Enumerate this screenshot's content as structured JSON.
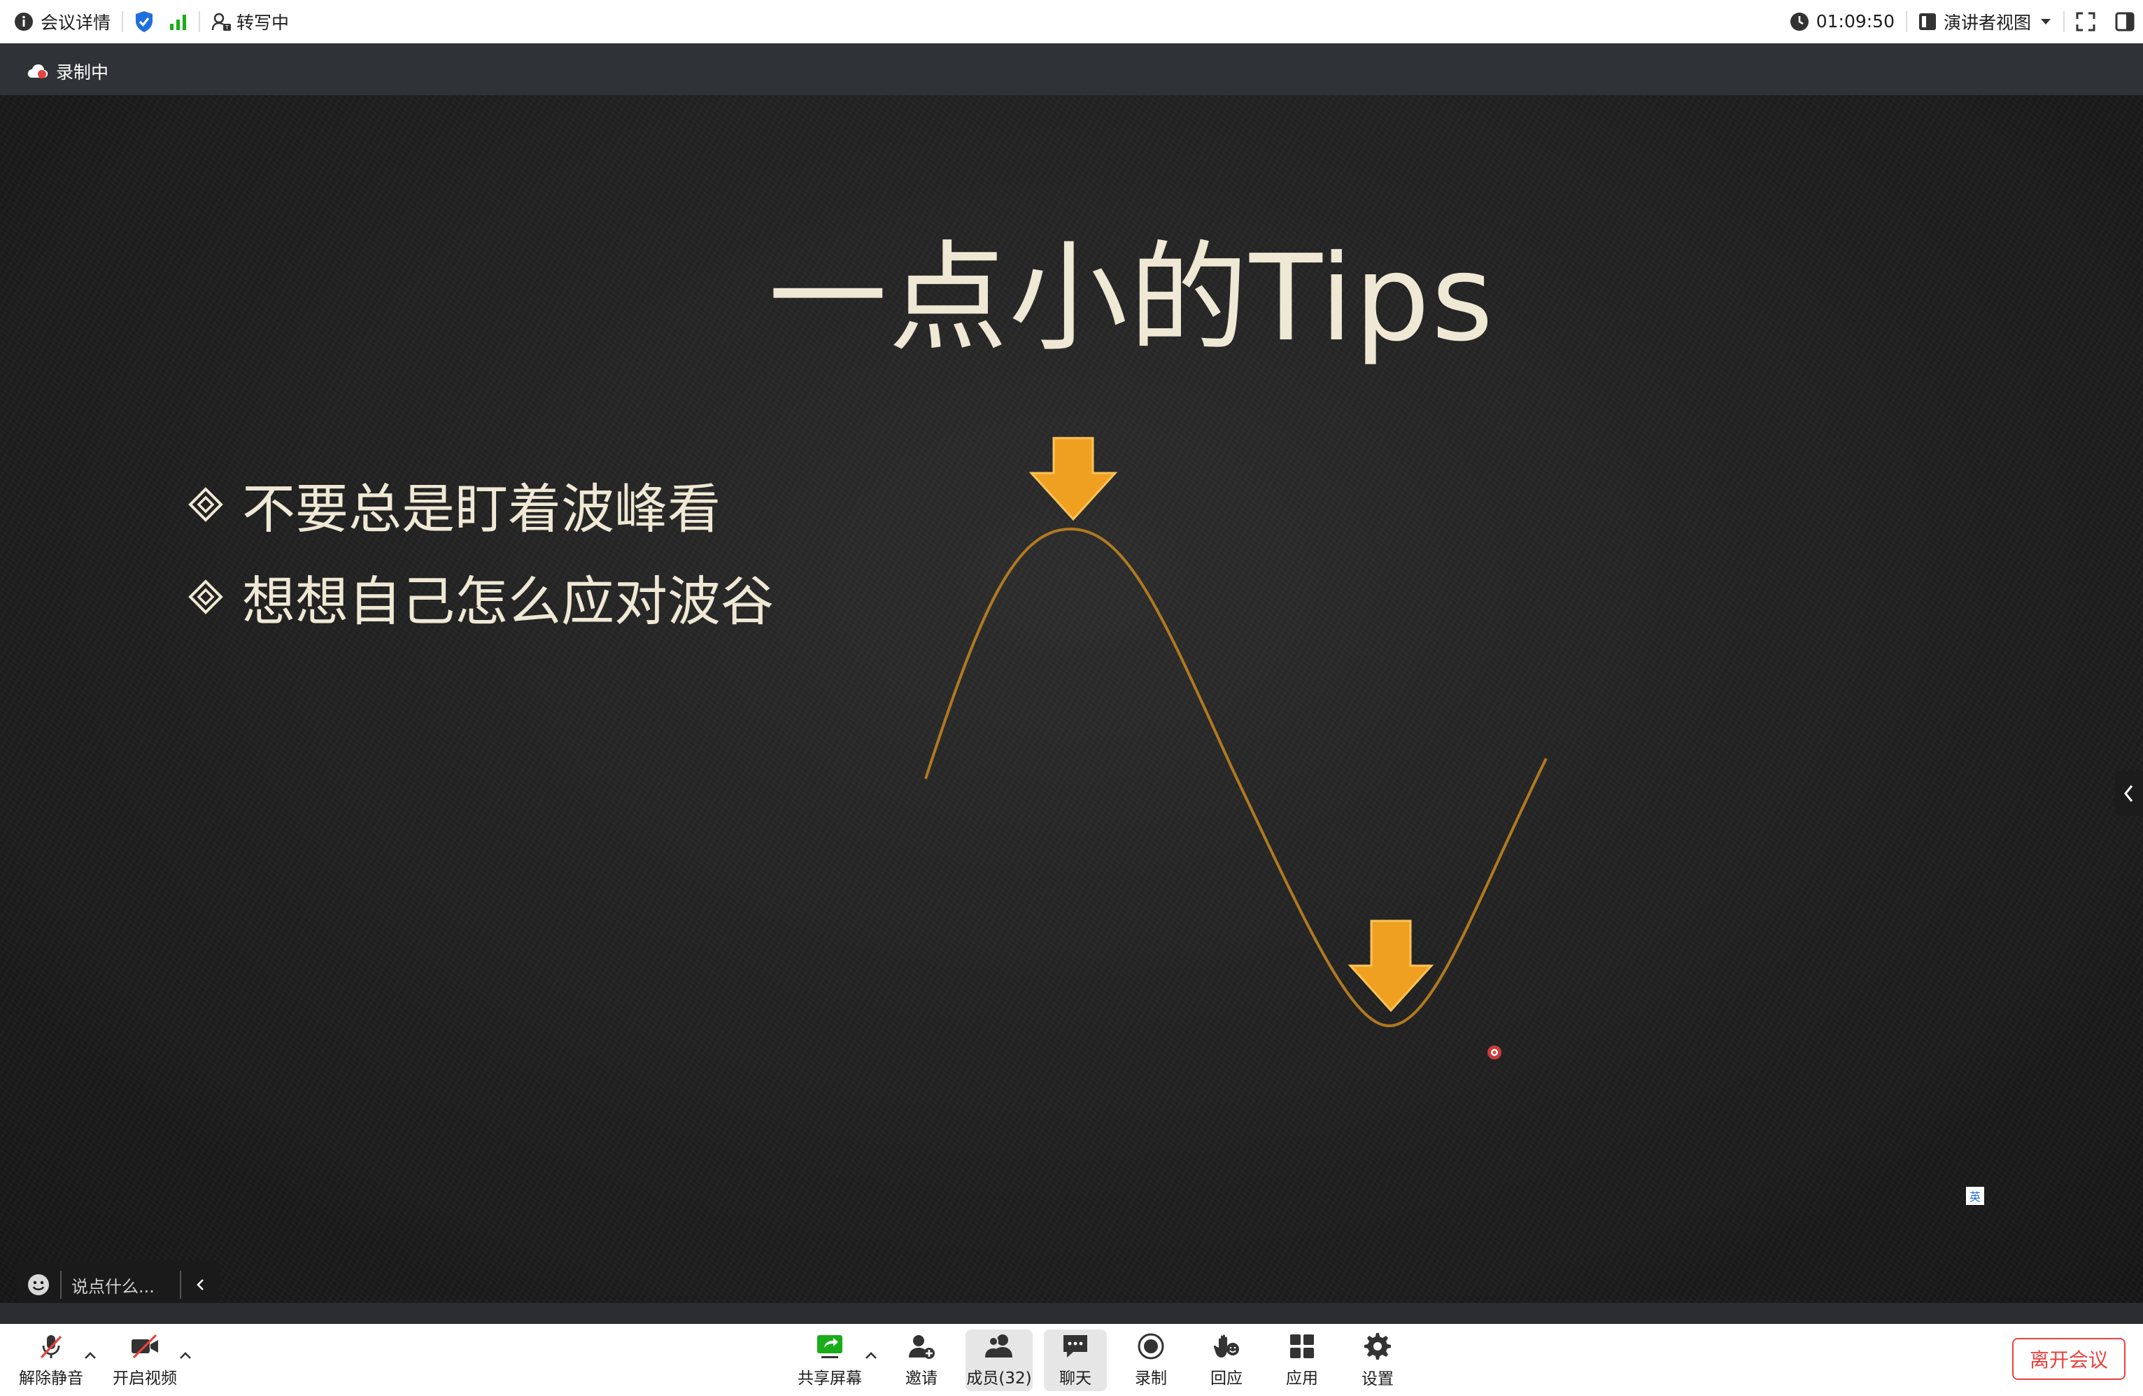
{
  "topbar": {
    "meeting_info_label": "会议详情",
    "transcribe_label": "转写中",
    "timer": "01:09:50",
    "view_mode_label": "演讲者视图"
  },
  "recording": {
    "label": "录制中"
  },
  "slide": {
    "title": "一点小的Tips",
    "bullets": [
      "不要总是盯着波峰看",
      "想想自己怎么应对波谷"
    ]
  },
  "chat": {
    "placeholder": "说点什么..."
  },
  "lang_badge": "英",
  "toolbar": {
    "unmute_label": "解除静音",
    "video_label": "开启视频",
    "share_label": "共享屏幕",
    "invite_label": "邀请",
    "members_label": "成员(32)",
    "chat_label": "聊天",
    "record_label": "录制",
    "react_label": "回应",
    "apps_label": "应用",
    "settings_label": "设置",
    "leave_label": "离开会议"
  },
  "colors": {
    "accent_red": "#e8433e",
    "arrow_orange": "#f0a020",
    "wave_color": "#b07a20",
    "slide_text": "#efe8d4",
    "signal_green": "#1aad19",
    "shield_blue": "#1f6fe0"
  }
}
